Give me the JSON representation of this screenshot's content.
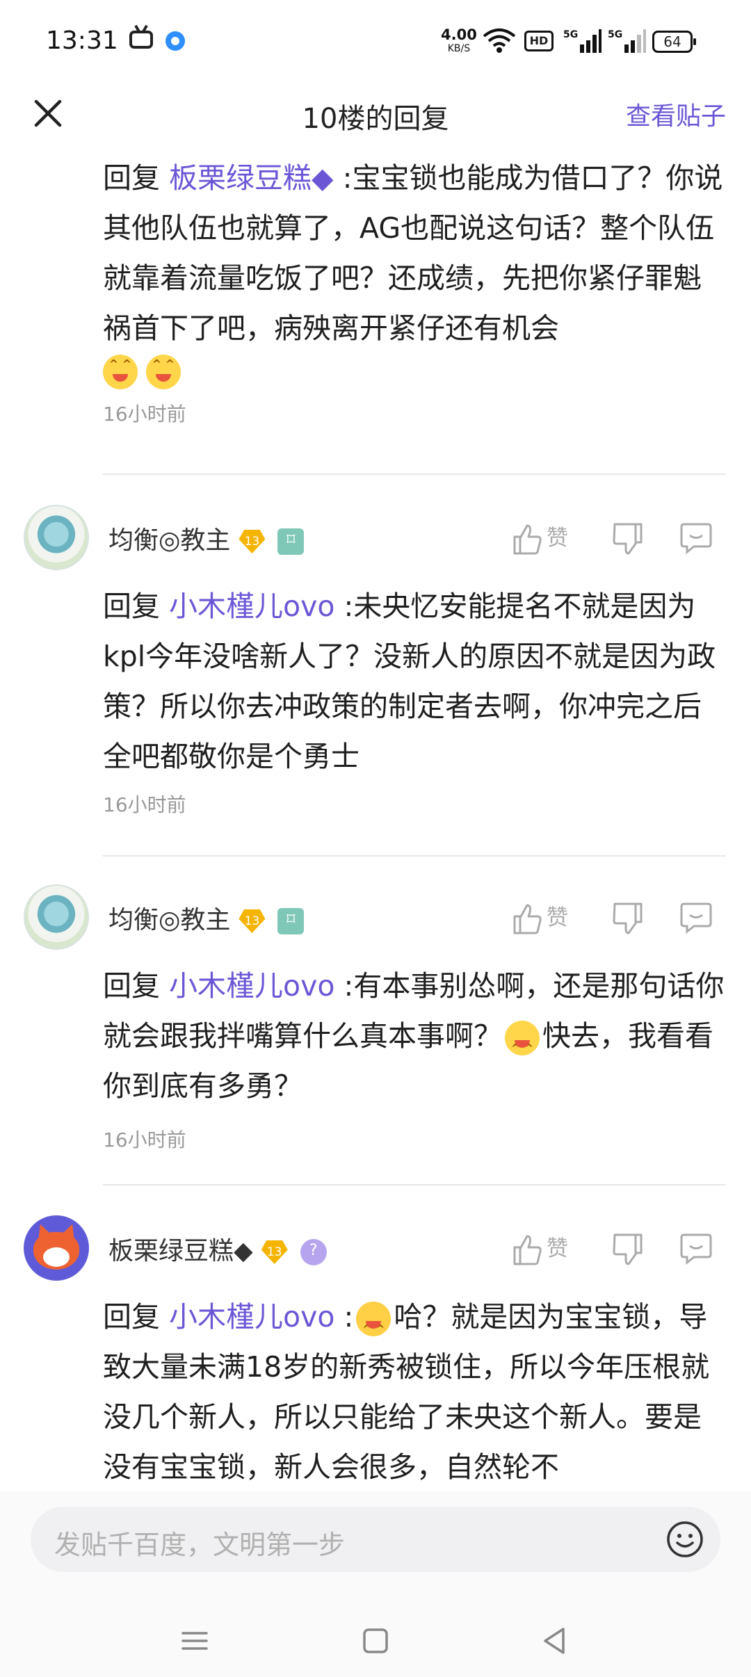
{
  "status_bar": {
    "time": "13:31",
    "net_speed_value": "4.00",
    "net_speed_unit": "KB/S",
    "hd_label": "HD",
    "network_label": "5G",
    "battery": "64"
  },
  "header": {
    "title": "10楼的回复",
    "view_post": "查看贴子"
  },
  "top_post": {
    "reply_prefix": "回复",
    "mention": "板栗绿豆糕◆",
    "text": ":宝宝锁也能成为借口了？你说其他队伍也就算了，AG也配说这句话？整个队伍就靠着流量吃饭了吧？还成绩，先把你紧仔罪魁祸首下了吧，病殃离开紧仔还有机会",
    "time": "16小时前"
  },
  "comments": [
    {
      "username": "均衡◎教主",
      "level": "13",
      "like_label": "赞",
      "reply_prefix": "回复",
      "mention": "小木槿儿ovo",
      "text": ":未央忆安能提名不就是因为kpl今年没啥新人了？没新人的原因不就是因为政策？所以你去冲政策的制定者去啊，你冲完之后全吧都敬你是个勇士",
      "time": "16小时前"
    },
    {
      "username": "均衡◎教主",
      "level": "13",
      "like_label": "赞",
      "reply_prefix": "回复",
      "mention": "小木槿儿ovo",
      "text_a": ":有本事别怂啊，还是那句话你就会跟我拌嘴算什么真本事啊？",
      "text_b": "快去，我看看你到底有多勇？",
      "time": "16小时前"
    },
    {
      "username": "板栗绿豆糕◆",
      "level": "13",
      "like_label": "赞",
      "reply_prefix": "回复",
      "mention": "小木槿儿ovo",
      "text_a": ":",
      "text_b": "哈？就是因为宝宝锁，导致大量未满18岁的新秀被锁住，所以今年压根就没几个新人，所以只能给了未央这个新人。要是没有宝宝锁，新人会很多，自然轮不"
    }
  ],
  "input": {
    "placeholder": "发贴千百度，文明第一步"
  },
  "colors": {
    "accent": "#6b57d6",
    "text": "#1f1f1f",
    "muted": "#999999"
  }
}
